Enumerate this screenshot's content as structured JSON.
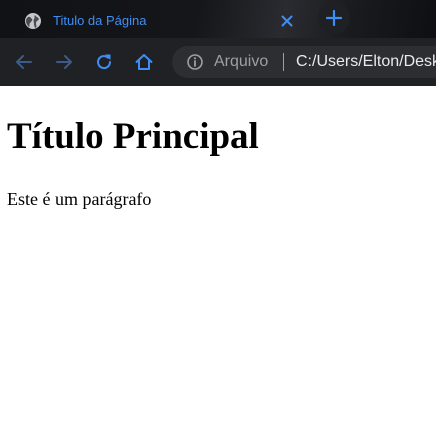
{
  "tab": {
    "title": "Titulo da Página",
    "favicon": "globe-icon",
    "close_icon": "close-icon"
  },
  "new_tab_icon": "plus-icon",
  "toolbar": {
    "back_icon": "arrow-left-icon",
    "forward_icon": "arrow-right-icon",
    "reload_icon": "reload-icon",
    "home_icon": "home-icon"
  },
  "address_bar": {
    "info_icon": "info-icon",
    "scheme_label": "Arquivo",
    "url": "C:/Users/Elton/Desktop/index.html"
  },
  "page": {
    "heading": "Título Principal",
    "paragraph": "Este é um parágrafo"
  },
  "colors": {
    "accent": "#3f8ef5",
    "toolbar_bg": "#202124",
    "omnibox_bg": "#2d2e31",
    "page_bg": "#ffffff"
  }
}
